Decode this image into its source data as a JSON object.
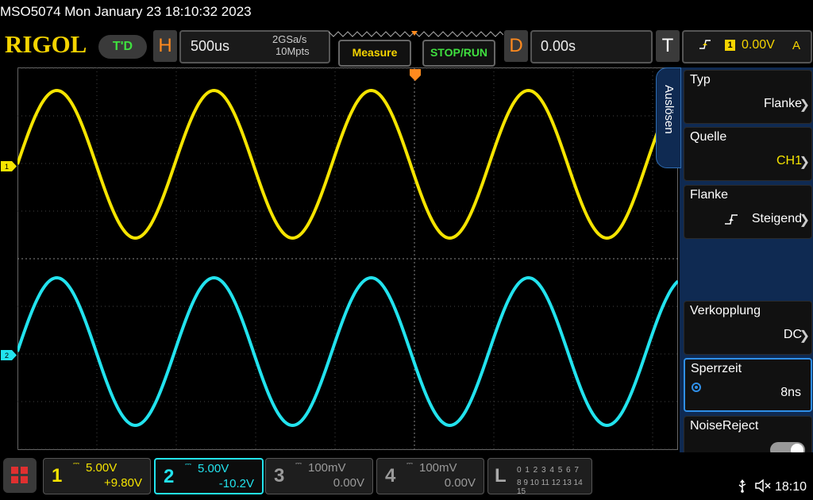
{
  "title_bar": {
    "text": "MSO5074  Mon January 23 18:10:32 2023"
  },
  "toolbar": {
    "logo": "RIGOL",
    "mode_badge": "T'D",
    "horizontal": {
      "letter": "H",
      "timebase": "500us",
      "sample_rate": "2GSa/s",
      "memory_depth": "10Mpts"
    },
    "measure_label": "Measure",
    "stoprun_label": "STOP/RUN",
    "delay": {
      "letter": "D",
      "value": "0.00s"
    },
    "trigger": {
      "letter": "T",
      "source": "1",
      "level": "0.00V",
      "mode": "A",
      "edge_icon": "rising-edge-icon"
    }
  },
  "colors": {
    "ch1": "#f5e400",
    "ch2": "#22e3ee",
    "accent_orange": "#ff8a1e",
    "menu_blue": "#0f2a52"
  },
  "waveforms": [
    {
      "channel": "1",
      "marker": "1",
      "color": "#f5e400"
    },
    {
      "channel": "2",
      "marker": "2",
      "color": "#22e3ee"
    }
  ],
  "side_menu": {
    "title": "Auslösen",
    "items": [
      {
        "label": "Typ",
        "value": "Flanke",
        "chevron": true
      },
      {
        "label": "Quelle",
        "value": "CH1",
        "value_color": "#f5e400",
        "chevron": true
      },
      {
        "label": "Flanke",
        "value": "Steigend",
        "icon": "rising-edge-icon",
        "chevron": true
      },
      {
        "label": "Verkopplung",
        "value": "DC",
        "chevron": true
      },
      {
        "label": "Sperrzeit",
        "value": "8ns",
        "icon": "rotary-knob-icon",
        "selected": true
      },
      {
        "label": "NoiseReject",
        "toggle": "off"
      }
    ]
  },
  "channels": [
    {
      "num": "1",
      "scale": "5.00V",
      "offset": "+9.80V",
      "color": "#f5e400",
      "active": true
    },
    {
      "num": "2",
      "scale": "5.00V",
      "offset": "-10.2V",
      "color": "#22e3ee",
      "active": true
    },
    {
      "num": "3",
      "scale": "100mV",
      "offset": "0.00V",
      "color": "#9a9a9a",
      "active": false
    },
    {
      "num": "4",
      "scale": "100mV",
      "offset": "0.00V",
      "color": "#9a9a9a",
      "active": false
    }
  ],
  "logic": {
    "letter": "L",
    "row1": "0 1 2 3  4 5 6 7",
    "row2": "8 9 10 11 12 13 14 15"
  },
  "status": {
    "clock": "18:10",
    "usb_icon": "usb-icon",
    "speaker_icon": "speaker-muted-icon"
  }
}
